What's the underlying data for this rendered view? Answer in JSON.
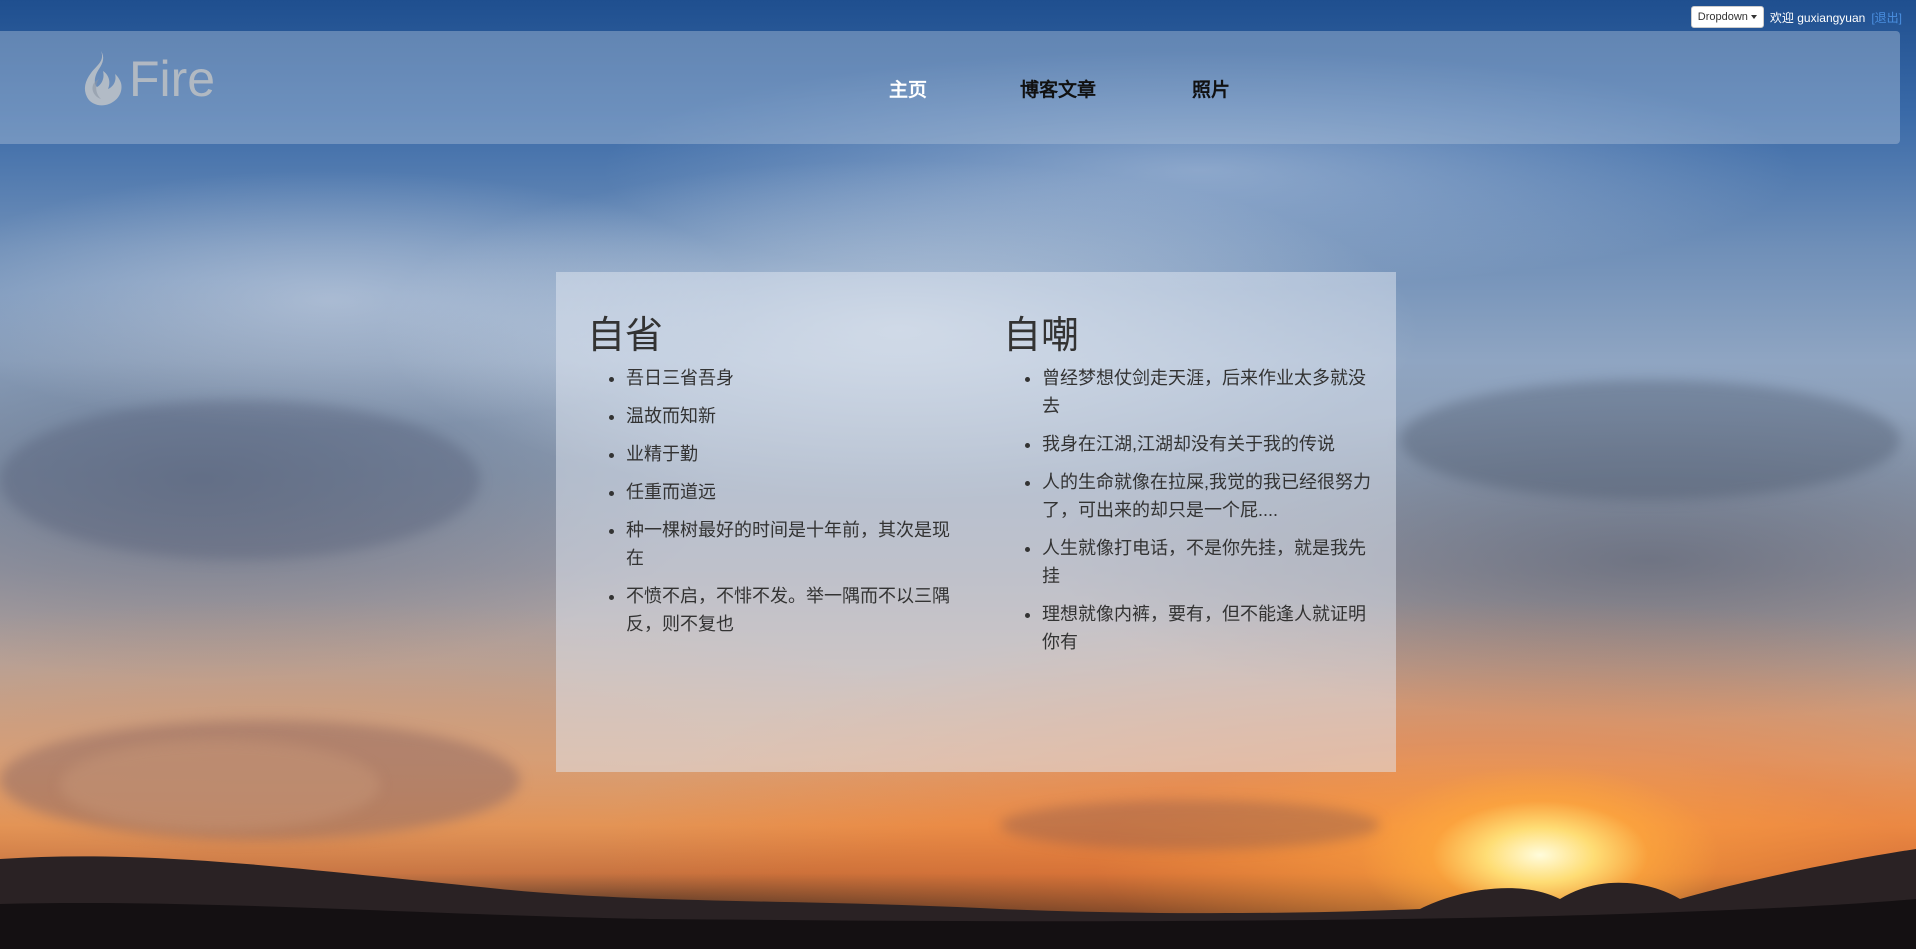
{
  "topbar": {
    "dropdown_label": "Dropdown",
    "welcome_text": "欢迎 guxiangyuan",
    "logout_label": "[退出]"
  },
  "header": {
    "logo_text": "Fire",
    "nav": [
      {
        "label": "主页",
        "active": true
      },
      {
        "label": "博客文章",
        "active": false
      },
      {
        "label": "照片",
        "active": false
      }
    ]
  },
  "content": {
    "left": {
      "title": "自省",
      "items": [
        "吾日三省吾身",
        "温故而知新",
        "业精于勤",
        "任重而道远",
        "种一棵树最好的时间是十年前，其次是现在",
        "不愤不启，不悱不发。举一隅而不以三隅反，则不复也"
      ]
    },
    "right": {
      "title": "自嘲",
      "items": [
        "曾经梦想仗剑走天涯，后来作业太多就没去",
        "我身在江湖,江湖却没有关于我的传说",
        "人的生命就像在拉屎,我觉的我已经很努力了，可出来的却只是一个屁....",
        "人生就像打电话，不是你先挂，就是我先挂",
        "理想就像内裤，要有，但不能逢人就证明你有"
      ]
    }
  },
  "colors": {
    "active_nav": "#ffffff",
    "nav": "#111111",
    "logout_link": "#4a8fe0"
  }
}
